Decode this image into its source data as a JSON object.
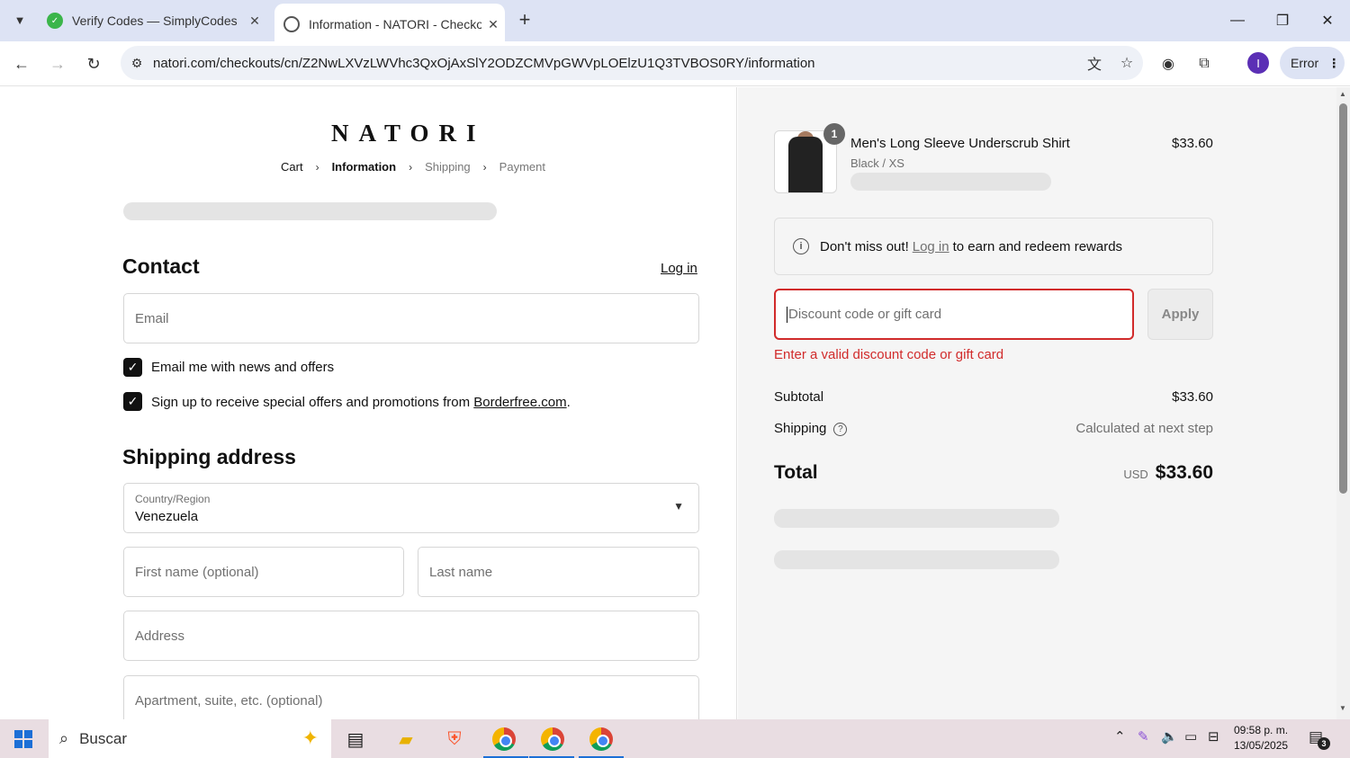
{
  "browser": {
    "tabs": [
      {
        "title": "Verify Codes — SimplyCodes",
        "active": false
      },
      {
        "title": "Information - NATORI - Checko",
        "active": true
      }
    ],
    "url": "natori.com/checkouts/cn/Z2NwLXVzLWVhc3QxOjAxSlY2ODZCMVpGWVpLOElzU1Q3TVBOS0RY/information",
    "profile_initial": "I",
    "error_label": "Error"
  },
  "checkout": {
    "logo": "NATORI",
    "breadcrumbs": [
      "Cart",
      "Information",
      "Shipping",
      "Payment"
    ],
    "contact_heading": "Contact",
    "login_link": "Log in",
    "email_placeholder": "Email",
    "checkbox_news": "Email me with news and offers",
    "checkbox_borderfree_prefix": "Sign up to receive special offers and promotions from ",
    "checkbox_borderfree_link": "Borderfree.com",
    "checkbox_borderfree_suffix": ".",
    "shipping_heading": "Shipping address",
    "country_label": "Country/Region",
    "country_value": "Venezuela",
    "first_name_placeholder": "First name (optional)",
    "last_name_placeholder": "Last name",
    "address_placeholder": "Address",
    "apartment_placeholder": "Apartment, suite, etc. (optional)"
  },
  "summary": {
    "item": {
      "quantity": "1",
      "name": "Men's Long Sleeve Underscrub Shirt",
      "variant": "Black / XS",
      "price": "$33.60"
    },
    "rewards": {
      "prefix": "Don't miss out!",
      "link": "Log in",
      "suffix": "to earn and redeem rewards"
    },
    "discount_placeholder": "Discount code or gift card",
    "apply_label": "Apply",
    "discount_error": "Enter a valid discount code or gift card",
    "subtotal_label": "Subtotal",
    "subtotal_value": "$33.60",
    "shipping_label": "Shipping",
    "shipping_value": "Calculated at next step",
    "total_label": "Total",
    "currency": "USD",
    "total_value": "$33.60"
  },
  "taskbar": {
    "search_label": "Buscar",
    "time": "09:58 p. m.",
    "date": "13/05/2025",
    "notification_count": "3"
  }
}
